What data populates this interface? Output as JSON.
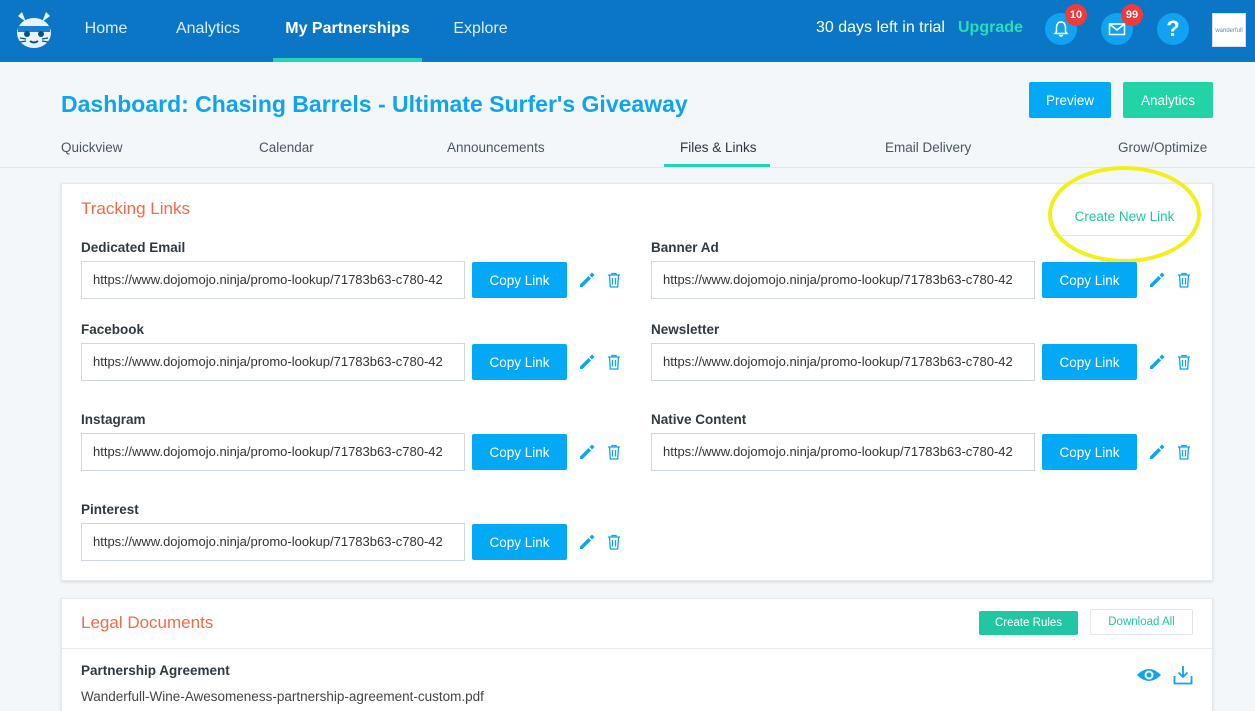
{
  "nav": {
    "items": [
      {
        "label": "Home"
      },
      {
        "label": "Analytics"
      },
      {
        "label": "My Partnerships"
      },
      {
        "label": "Explore"
      }
    ],
    "trial_text": "30 days left in trial",
    "upgrade_label": "Upgrade",
    "notifications_count": "10",
    "messages_count": "99",
    "help_label": "?",
    "avatar_text": "wanderfull"
  },
  "header": {
    "title": "Dashboard: Chasing Barrels - Ultimate Surfer's Giveaway",
    "preview_label": "Preview",
    "analytics_label": "Analytics",
    "tabs": [
      {
        "label": "Quickview"
      },
      {
        "label": "Calendar"
      },
      {
        "label": "Announcements"
      },
      {
        "label": "Files & Links"
      },
      {
        "label": "Email Delivery"
      },
      {
        "label": "Grow/Optimize"
      }
    ],
    "active_tab": "Files & Links"
  },
  "tracking": {
    "title": "Tracking Links",
    "create_label": "Create New Link",
    "copy_label": "Copy Link",
    "links": [
      {
        "label": "Dedicated Email",
        "url": "https://www.dojomojo.ninja/promo-lookup/71783b63-c780-42"
      },
      {
        "label": "Banner Ad",
        "url": "https://www.dojomojo.ninja/promo-lookup/71783b63-c780-42"
      },
      {
        "label": "Facebook",
        "url": "https://www.dojomojo.ninja/promo-lookup/71783b63-c780-42"
      },
      {
        "label": "Newsletter",
        "url": "https://www.dojomojo.ninja/promo-lookup/71783b63-c780-42"
      },
      {
        "label": "Instagram",
        "url": "https://www.dojomojo.ninja/promo-lookup/71783b63-c780-42"
      },
      {
        "label": "Native Content",
        "url": "https://www.dojomojo.ninja/promo-lookup/71783b63-c780-42"
      },
      {
        "label": "Pinterest",
        "url": "https://www.dojomojo.ninja/promo-lookup/71783b63-c780-42"
      }
    ]
  },
  "legal": {
    "title": "Legal Documents",
    "create_rules_label": "Create Rules",
    "download_all_label": "Download All",
    "documents": [
      {
        "title": "Partnership Agreement",
        "filename": "Wanderfull-Wine-Awesomeness-partnership-agreement-custom.pdf"
      }
    ]
  },
  "colors": {
    "nav_bg": "#0b76c5",
    "primary_button": "#03a9f4",
    "accent_green": "#22d3a5",
    "section_title": "#f26b46",
    "highlight_ring": "#f3ef1b"
  }
}
